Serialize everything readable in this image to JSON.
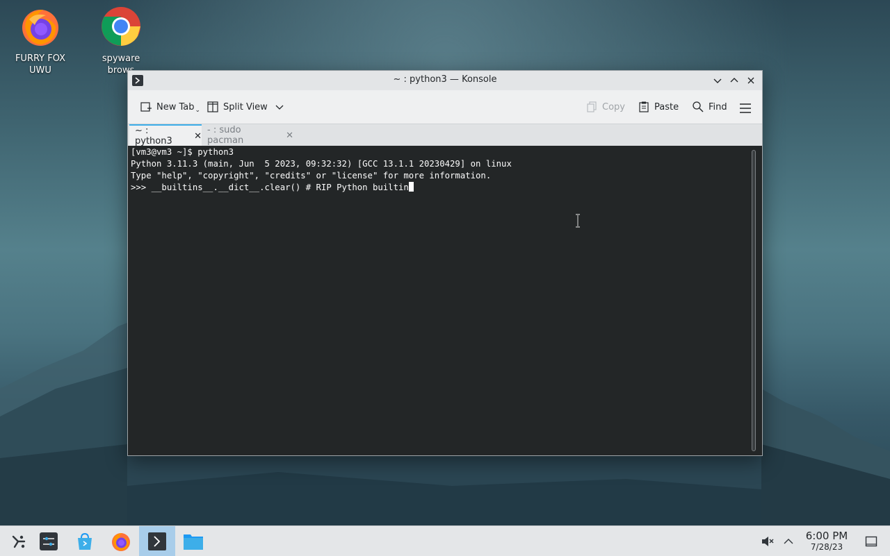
{
  "desktop": {
    "icons": [
      {
        "label": "FURRY FOX UWU",
        "icon": "firefox-icon"
      },
      {
        "label": "spyware\nbrows",
        "icon": "chrome-icon"
      }
    ]
  },
  "window": {
    "title": "~ : python3 — Konsole",
    "toolbar": {
      "new_tab": "New Tab",
      "split_view": "Split View",
      "copy": "Copy",
      "paste": "Paste",
      "find": "Find"
    },
    "tabs": [
      {
        "label": "~ : python3",
        "active": true
      },
      {
        "label": "- : sudo pacman",
        "active": false
      }
    ],
    "terminal": {
      "lines": [
        "[vm3@vm3 ~]$ python3",
        "Python 3.11.3 (main, Jun  5 2023, 09:32:32) [GCC 13.1.1 20230429] on linux",
        "Type \"help\", \"copyright\", \"credits\" or \"license\" for more information.",
        ">>> __builtins__.__dict__.clear() # RIP Python builtin"
      ]
    }
  },
  "taskbar": {
    "items": [
      "application-launcher-icon",
      "settings-icon",
      "discover-store-icon",
      "firefox-icon",
      "konsole-icon",
      "file-manager-icon"
    ],
    "clock": {
      "time": "6:00 PM",
      "date": "7/28/23"
    }
  },
  "colors": {
    "accent": "#3daee9",
    "terminal_bg": "#232627",
    "active_task": "#a8cdea"
  }
}
